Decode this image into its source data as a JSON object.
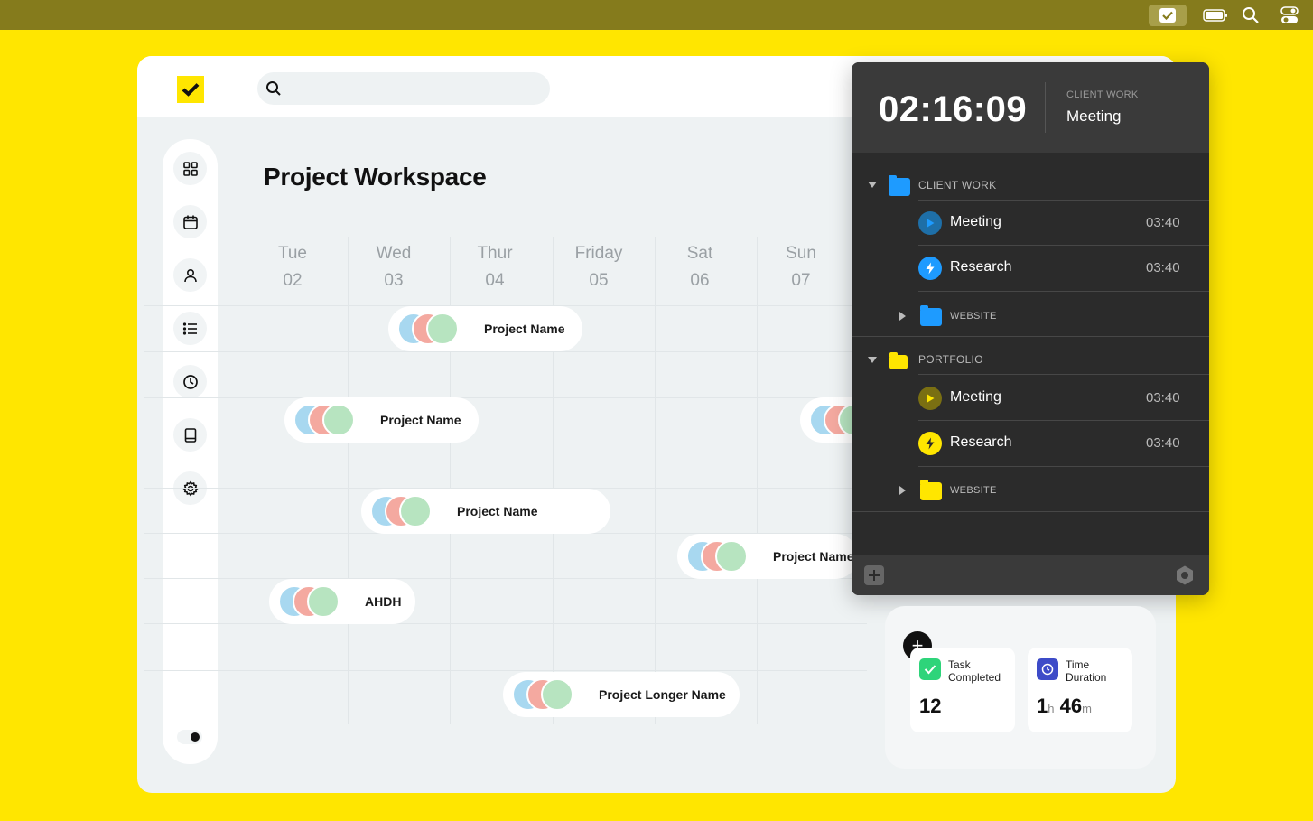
{
  "menubar": {
    "icons": [
      "check-app-icon",
      "battery-icon",
      "spotlight-search-icon",
      "control-center-icon"
    ]
  },
  "search": {
    "placeholder": "",
    "value": ""
  },
  "sidebar": {
    "items": [
      "dashboard-icon",
      "calendar-icon",
      "user-icon",
      "list-icon",
      "clock-icon",
      "book-icon",
      "settings-icon"
    ]
  },
  "page": {
    "title": "Project Workspace"
  },
  "calendar": {
    "days": [
      {
        "name": "Tue",
        "date": "02"
      },
      {
        "name": "Wed",
        "date": "03"
      },
      {
        "name": "Thur",
        "date": "04"
      },
      {
        "name": "Friday",
        "date": "05"
      },
      {
        "name": "Sat",
        "date": "06"
      },
      {
        "name": "Sun",
        "date": "07"
      }
    ],
    "projects": [
      {
        "label": "Project Name"
      },
      {
        "label": "Project Name"
      },
      {
        "label": ""
      },
      {
        "label": "Project Name"
      },
      {
        "label": "Project Name"
      },
      {
        "label": "AHDH"
      },
      {
        "label": "Project Longer Name"
      }
    ]
  },
  "timer": {
    "clock": "02:16:09",
    "current_category": "CLIENT WORK",
    "current_task": "Meeting",
    "groups": [
      {
        "label": "CLIENT WORK",
        "color": "#1E9BFF",
        "tasks": [
          {
            "name": "Meeting",
            "time": "03:40",
            "icon": "play-icon"
          },
          {
            "name": "Research",
            "time": "03:40",
            "icon": "bolt-icon"
          }
        ],
        "subfolder": "WEBSITE"
      },
      {
        "label": "PORTFOLIO",
        "color": "#FFE600",
        "tasks": [
          {
            "name": "Meeting",
            "time": "03:40",
            "icon": "play-icon"
          },
          {
            "name": "Research",
            "time": "03:40",
            "icon": "bolt-icon"
          }
        ],
        "subfolder": "WEBSITE"
      }
    ]
  },
  "stats": {
    "task_completed": {
      "label": "Task Completed",
      "value": "12"
    },
    "time_duration": {
      "label": "Time Duration",
      "hours": "1",
      "hours_unit": "h",
      "minutes": "46",
      "minutes_unit": "m"
    }
  },
  "colors": {
    "background": "#FFE600",
    "accent_blue": "#1E9BFF",
    "accent_yellow": "#FFE600",
    "accent_green": "#2ED47A",
    "accent_indigo": "#3D4BC8",
    "panel_dark": "#2B2B2B"
  }
}
